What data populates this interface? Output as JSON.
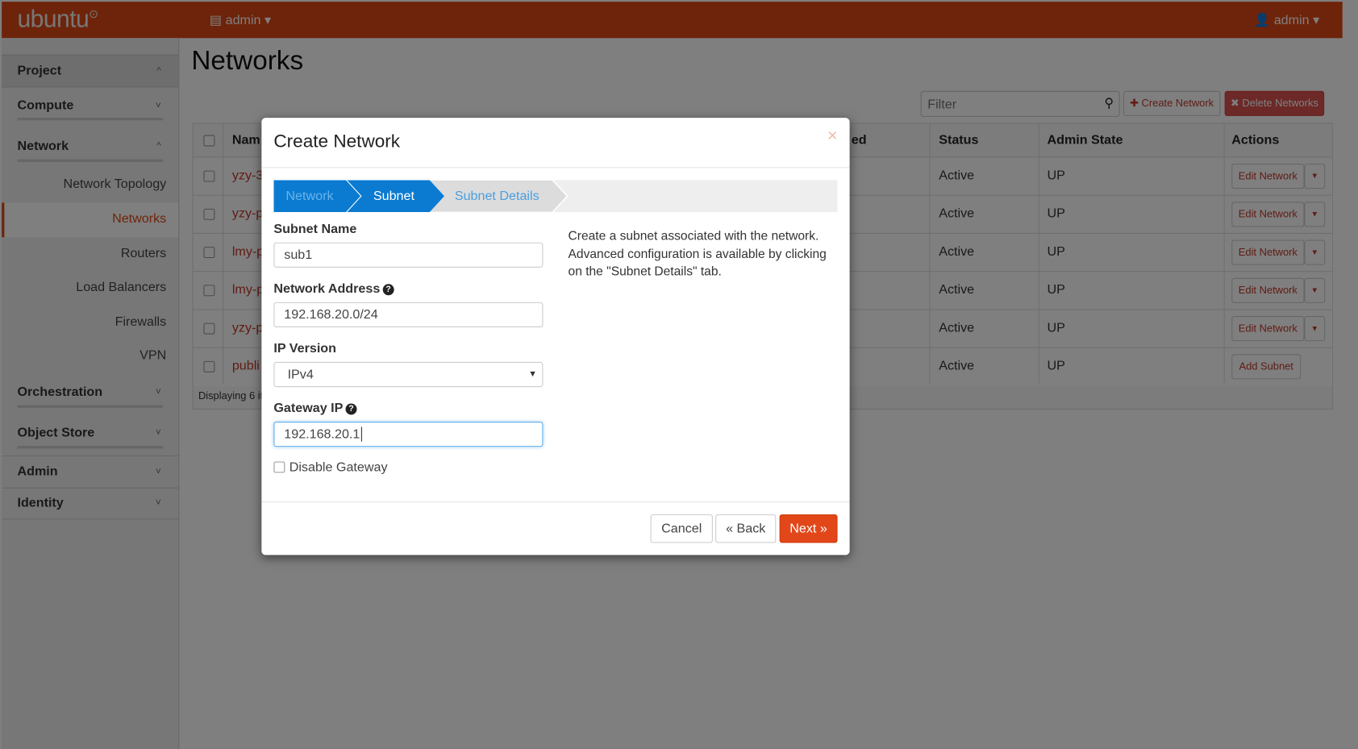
{
  "header": {
    "logo": "ubuntu",
    "project_selector": "admin",
    "user_menu": "admin"
  },
  "sidebar": {
    "sections": [
      "Project",
      "Compute",
      "Network",
      "Orchestration",
      "Object Store",
      "Admin",
      "Identity"
    ],
    "network_items": [
      "Network Topology",
      "Networks",
      "Routers",
      "Load Balancers",
      "Firewalls",
      "VPN"
    ],
    "active_item": "Networks"
  },
  "page": {
    "title": "Networks",
    "filter_placeholder": "Filter",
    "create_label": "Create Network",
    "delete_label": "Delete Networks"
  },
  "table": {
    "headers": {
      "name": "Nam",
      "shared": "ed",
      "status": "Status",
      "admin_state": "Admin State",
      "actions": "Actions"
    },
    "rows": [
      {
        "name": "yzy-3",
        "status": "Active",
        "admin_state": "UP",
        "action": "Edit Network"
      },
      {
        "name": "yzy-p",
        "status": "Active",
        "admin_state": "UP",
        "action": "Edit Network"
      },
      {
        "name": "lmy-p",
        "status": "Active",
        "admin_state": "UP",
        "action": "Edit Network"
      },
      {
        "name": "lmy-p",
        "status": "Active",
        "admin_state": "UP",
        "action": "Edit Network"
      },
      {
        "name": "yzy-p",
        "status": "Active",
        "admin_state": "UP",
        "action": "Edit Network"
      },
      {
        "name": "publi",
        "status": "Active",
        "admin_state": "UP",
        "action": "Add Subnet"
      }
    ],
    "footer": "Displaying 6 it"
  },
  "modal": {
    "title": "Create Network",
    "close": "×",
    "steps": [
      "Network",
      "Subnet",
      "Subnet Details"
    ],
    "subnet_name_label": "Subnet Name",
    "subnet_name_value": "sub1",
    "network_address_label": "Network Address",
    "network_address_value": "192.168.20.0/24",
    "ip_version_label": "IP Version",
    "ip_version_value": "IPv4",
    "gateway_label": "Gateway IP",
    "gateway_value": "192.168.20.1",
    "disable_gateway_label": "Disable Gateway",
    "description": "Create a subnet associated with the network. Advanced configuration is available by clicking on the \"Subnet Details\" tab.",
    "cancel": "Cancel",
    "back": "« Back",
    "next": "Next »"
  },
  "colors": {
    "brand": "#dd4814",
    "wizard_active": "#0a7bd1",
    "danger": "#d9534f"
  }
}
